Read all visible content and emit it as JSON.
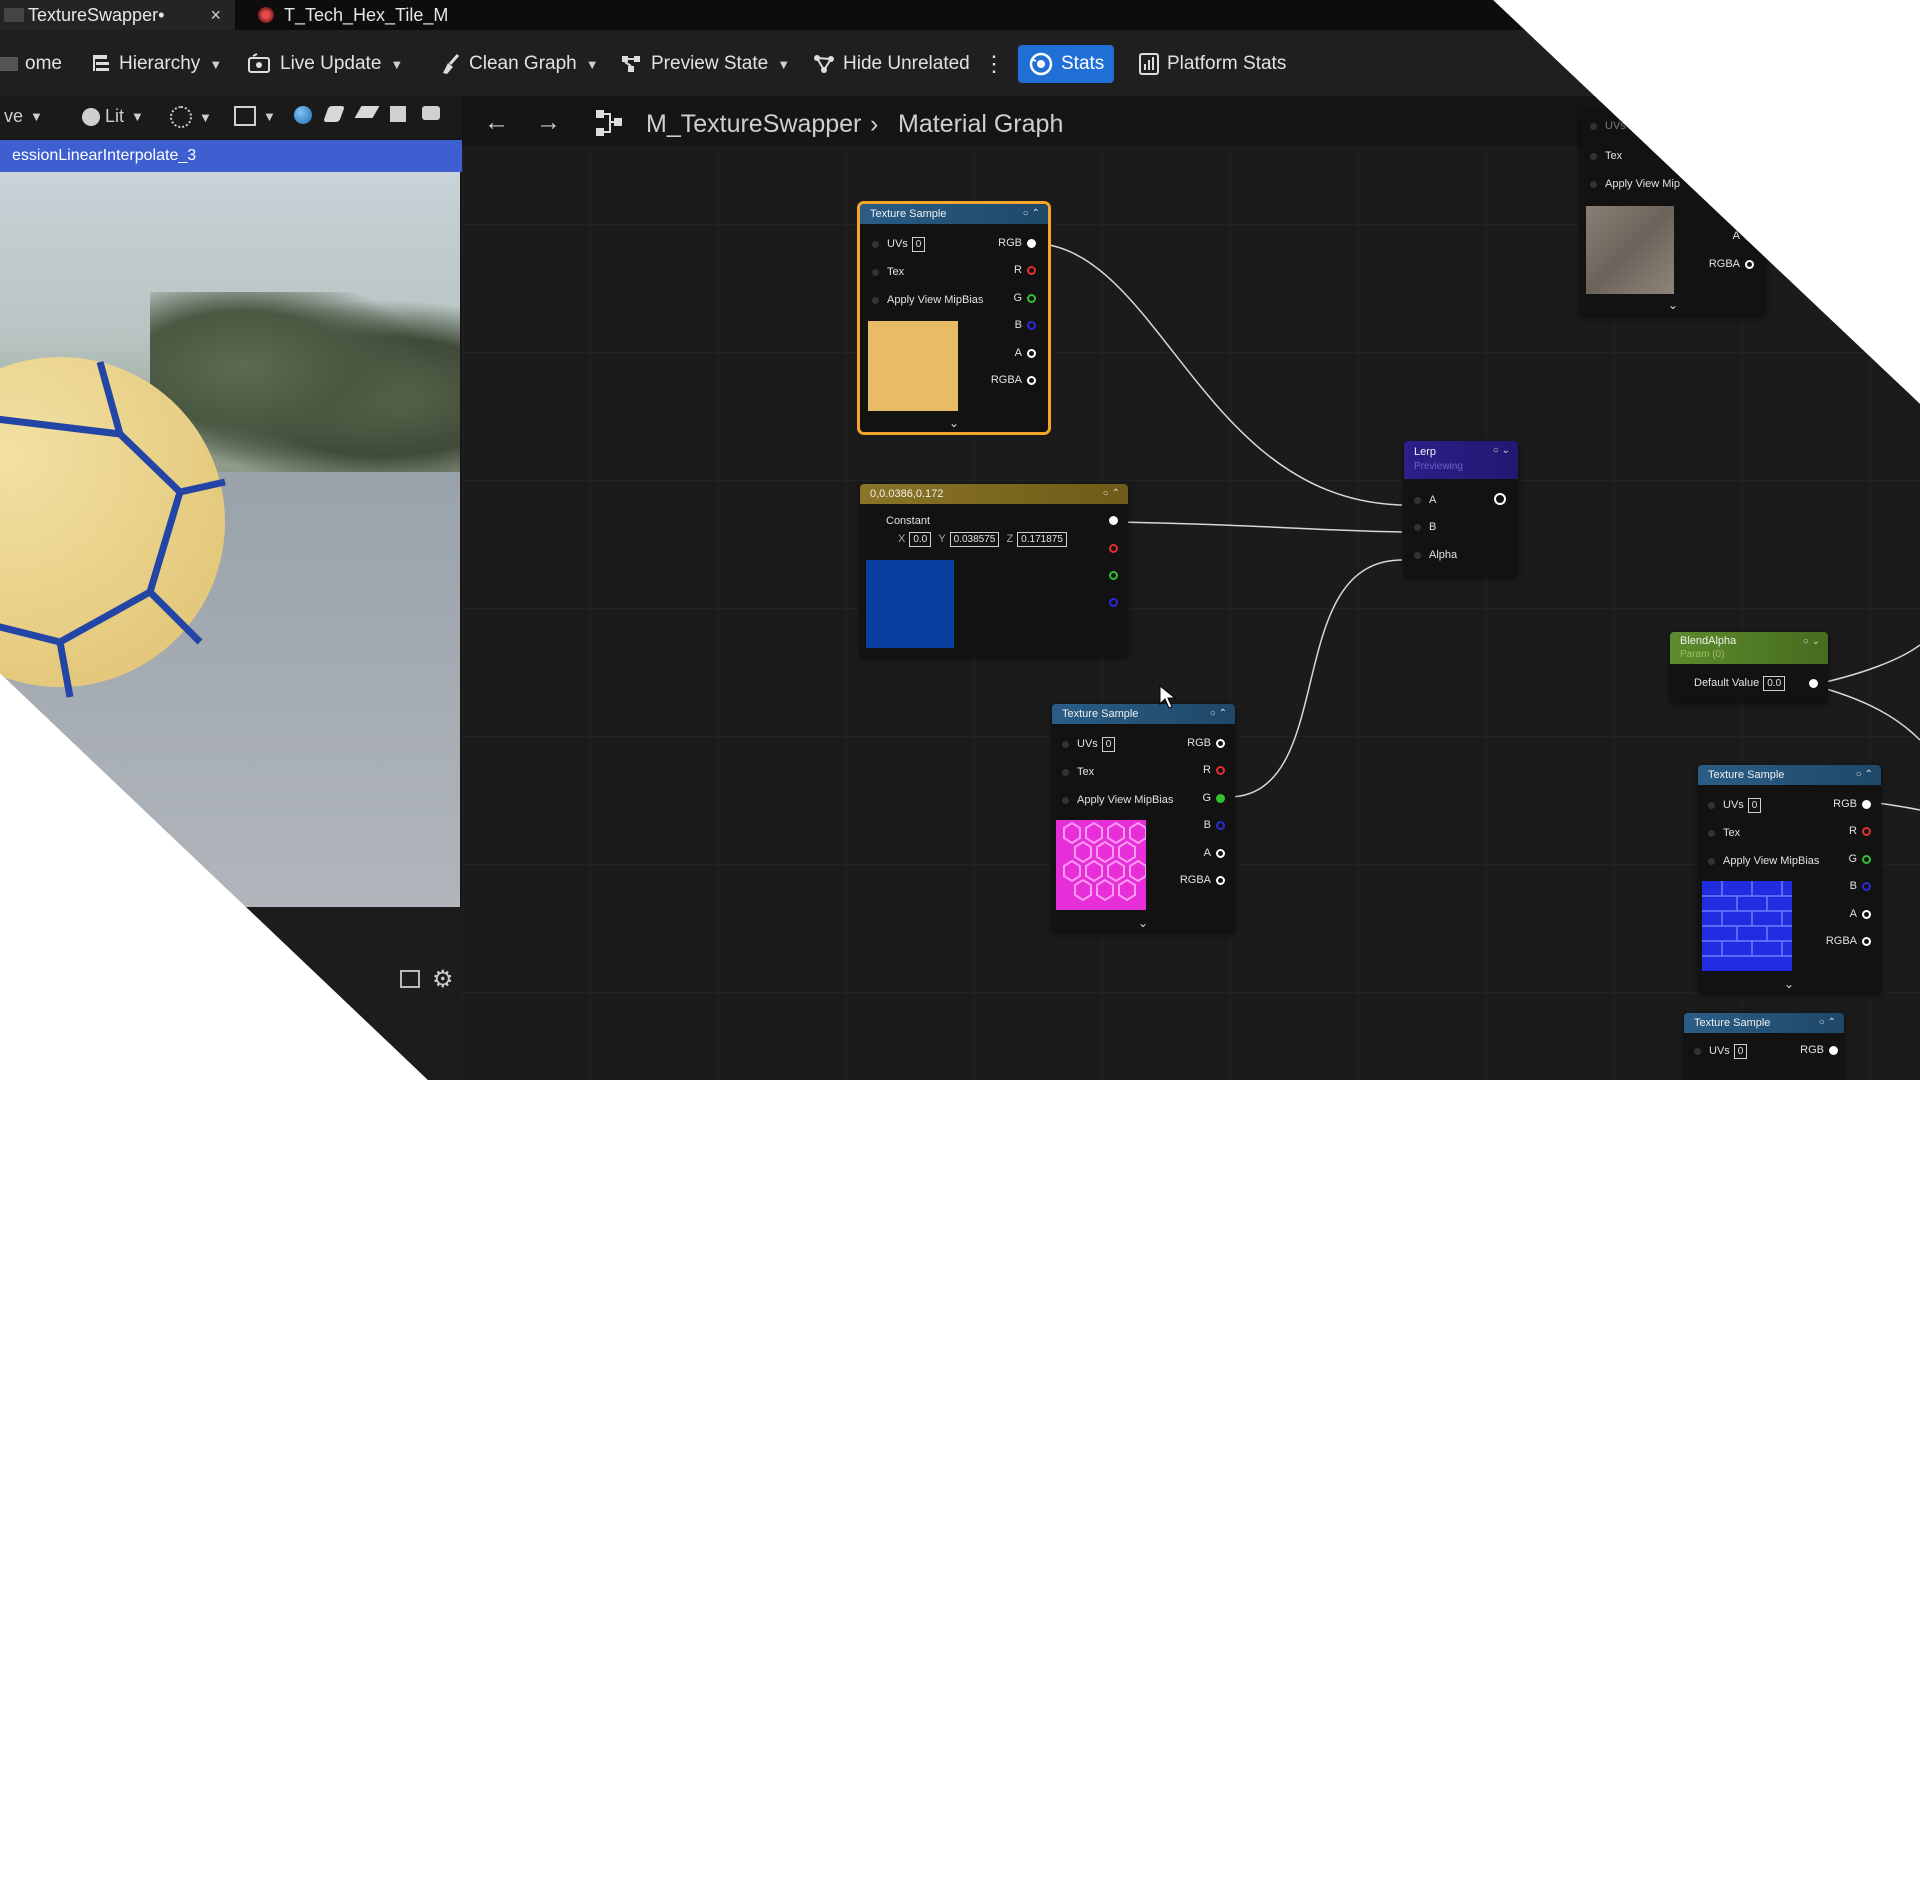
{
  "tabs": [
    {
      "label": "TextureSwapper•",
      "close": "×"
    },
    {
      "label": "T_Tech_Hex_Tile_M"
    }
  ],
  "toolbar": {
    "home": "ome",
    "hierarchy": "Hierarchy",
    "live_update": "Live Update",
    "clean_graph": "Clean Graph",
    "preview_state": "Preview State",
    "hide_unrelated": "Hide Unrelated",
    "stats": "Stats",
    "platform_stats": "Platform Stats"
  },
  "viewport": {
    "mode_cut": "ve",
    "lit": "Lit",
    "header": "essionLinearInterpolate_3"
  },
  "breadcrumb": {
    "asset": "M_TextureSwapper",
    "separator": "›",
    "graph": "Material Graph"
  },
  "nodes": {
    "tex1": {
      "title": "Texture Sample",
      "uvs": "UVs",
      "uv_val": "0",
      "tex": "Tex",
      "mip": "Apply View MipBias",
      "rgb": "RGB",
      "r": "R",
      "g": "G",
      "b": "B",
      "a": "A",
      "rgba": "RGBA",
      "swatch": "#e8bb65"
    },
    "const": {
      "title": "0,0.0386,0.172",
      "label": "Constant",
      "xl": "X",
      "x": "0.0",
      "yl": "Y",
      "y": "0.038575",
      "zl": "Z",
      "z": "0.171875",
      "swatch": "#0a3fa0"
    },
    "lerp": {
      "title": "Lerp",
      "sub": "Previewing",
      "a": "A",
      "b": "B",
      "alpha": "Alpha"
    },
    "tex2": {
      "title": "Texture Sample",
      "uvs": "UVs",
      "uv_val": "0",
      "tex": "Tex",
      "mip": "Apply View MipBias",
      "rgb": "RGB",
      "r": "R",
      "g": "G",
      "b": "B",
      "a": "A",
      "rgba": "RGBA",
      "swatch": "#e62fd8"
    },
    "blend": {
      "title": "BlendAlpha",
      "sub": "Param (0)",
      "default": "Default Value",
      "val": "0.0"
    },
    "tex3": {
      "title": "Texture Sample",
      "uvs": "UVs",
      "uv_val": "0",
      "tex": "Tex",
      "mip": "Apply View MipBias",
      "rgb": "RGB",
      "r": "R",
      "g": "G",
      "b": "B",
      "a": "A",
      "rgba": "RGBA",
      "swatch": "#1f2ce0"
    },
    "tex4": {
      "title": "Texture Sample",
      "uvs": "UVs",
      "uv_val": "0",
      "rgb": "RGB"
    },
    "topright": {
      "uvs": "UVs",
      "tex": "Tex",
      "mip": "Apply View Mip",
      "a": "A",
      "rgba": "RGBA"
    }
  }
}
